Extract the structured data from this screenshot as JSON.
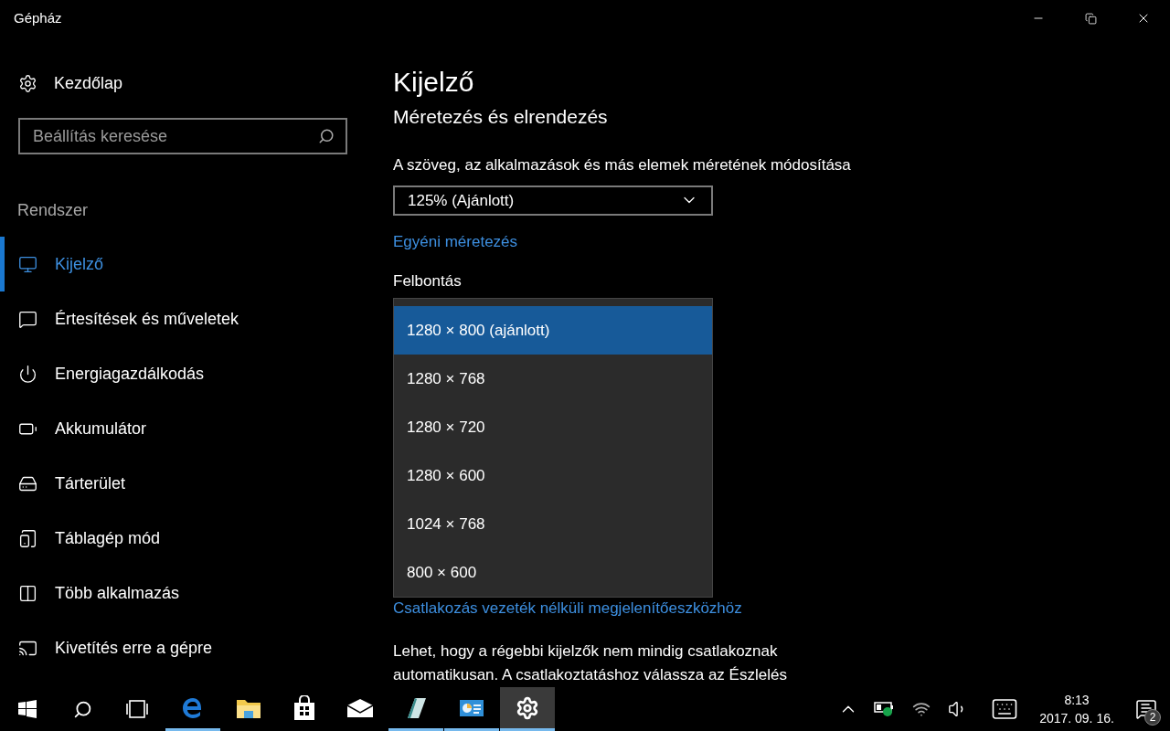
{
  "window": {
    "title": "Gépház"
  },
  "sidebar": {
    "home": "Kezdőlap",
    "search": {
      "placeholder": "Beállítás keresése"
    },
    "section": "Rendszer",
    "items": [
      {
        "label": "Kijelző",
        "selected": true
      },
      {
        "label": "Értesítések és műveletek",
        "selected": false
      },
      {
        "label": "Energiagazdálkodás",
        "selected": false
      },
      {
        "label": "Akkumulátor",
        "selected": false
      },
      {
        "label": "Tárterület",
        "selected": false
      },
      {
        "label": "Táblagép mód",
        "selected": false
      },
      {
        "label": "Több alkalmazás",
        "selected": false
      },
      {
        "label": "Kivetítés erre a gépre",
        "selected": false
      }
    ]
  },
  "page": {
    "title": "Kijelző",
    "section": "Méretezés és elrendezés",
    "scale_label": "A szöveg, az alkalmazások és más elemek méretének módosítása",
    "scale_value": "125% (Ajánlott)",
    "custom_link": "Egyéni méretezés",
    "resolution_label": "Felbontás",
    "wireless_link": "Csatlakozás vezeték nélküli megjelenítőeszközhöz",
    "paragraph": [
      "Lehet, hogy a régebbi kijelzők nem mindig csatlakoznak",
      "automatikusan. A csatlakoztatáshoz válassza az Észlelés"
    ]
  },
  "resolution_menu": [
    {
      "label": "1280 × 800 (ajánlott)",
      "selected": true
    },
    {
      "label": "1280 × 768",
      "selected": false
    },
    {
      "label": "1280 × 720",
      "selected": false
    },
    {
      "label": "1280 × 600",
      "selected": false
    },
    {
      "label": "1024 × 768",
      "selected": false
    },
    {
      "label": "800 × 600",
      "selected": false
    }
  ],
  "taskbar": {
    "apps": [
      {
        "running": true,
        "selected": false
      },
      {
        "running": false,
        "selected": false
      },
      {
        "running": false,
        "selected": false
      },
      {
        "running": false,
        "selected": false
      },
      {
        "running": true,
        "selected": false
      },
      {
        "running": true,
        "selected": false
      },
      {
        "running": true,
        "selected": true
      }
    ],
    "time": "8:13",
    "date": "2017. 09. 16.",
    "notifications": "2"
  }
}
